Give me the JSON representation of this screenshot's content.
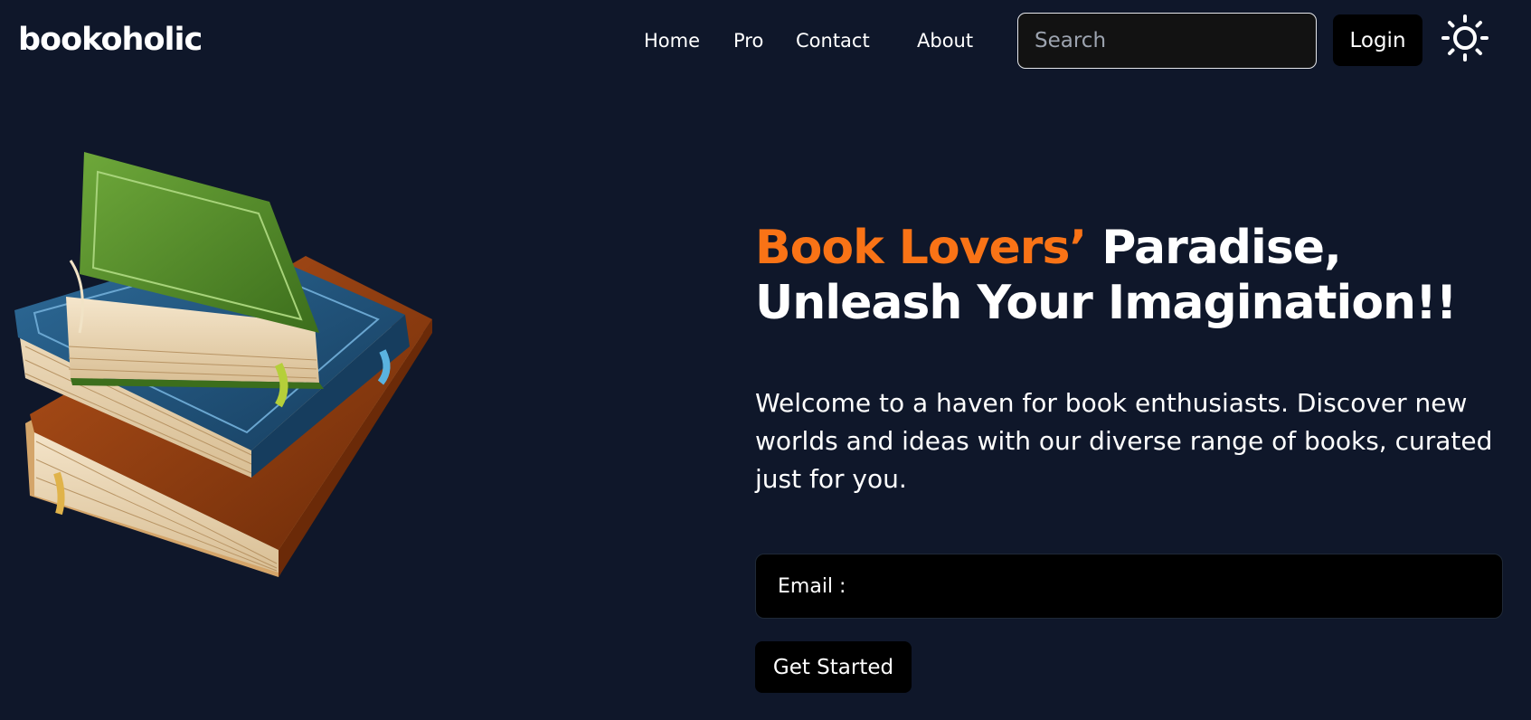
{
  "brand": {
    "name": "bookoholic"
  },
  "nav": {
    "links": [
      {
        "label": "Home"
      },
      {
        "label": "Pro"
      },
      {
        "label": "Contact"
      },
      {
        "label": "About"
      }
    ]
  },
  "search": {
    "placeholder": "Search",
    "value": ""
  },
  "login": {
    "label": "Login"
  },
  "theme_toggle": {
    "icon": "sun-icon"
  },
  "hero": {
    "heading_accent": "Book Lovers’",
    "heading_rest": " Paradise, Unleash Your Imagination!!",
    "description": "Welcome to a haven for book enthusiasts. Discover new worlds and ideas with our diverse range of books, curated just for you.",
    "image_icon": "book-stack-illustration",
    "email_label": "Email :",
    "email_value": "",
    "cta_label": "Get Started"
  },
  "colors": {
    "background": "#0f172a",
    "accent": "#f97316",
    "button": "#000000",
    "text": "#ffffff"
  }
}
